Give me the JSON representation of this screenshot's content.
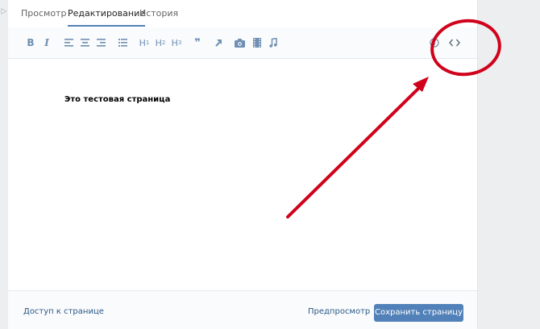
{
  "tabs": [
    {
      "label": "Просмотр"
    },
    {
      "label": "Редактирование"
    },
    {
      "label": "История"
    }
  ],
  "toolbar": {
    "bold": "B",
    "italic": "I",
    "h1": "H",
    "h2": "H",
    "h3": "H",
    "h1_sub": "1",
    "h2_sub": "2",
    "h3_sub": "3",
    "quote": "❞"
  },
  "editor": {
    "content": "Это тестовая страница"
  },
  "footer": {
    "access_label": "Доступ к странице",
    "preview_label": "Предпросмотр",
    "save_label": "Сохранить страницу"
  },
  "colors": {
    "accent": "#5181b8",
    "icon": "#6f8fb3",
    "annotation": "#d0021b"
  }
}
